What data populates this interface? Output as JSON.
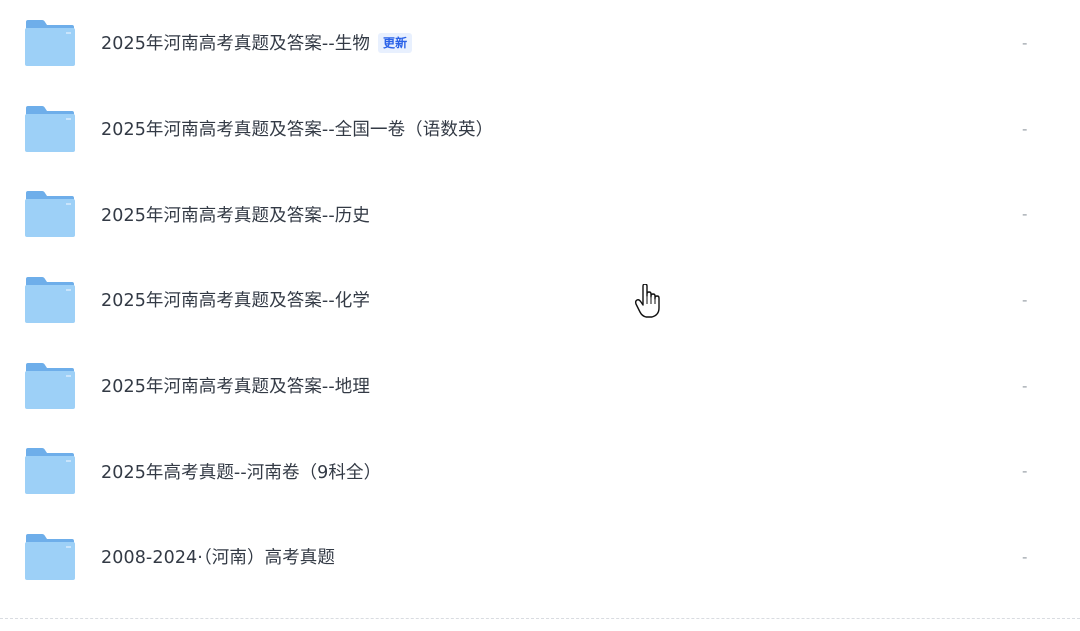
{
  "files": [
    {
      "name": "2025年河南高考真题及答案--生物",
      "badge": "更新",
      "meta": "-",
      "icon": "folder-icon"
    },
    {
      "name": "2025年河南高考真题及答案--全国一卷（语数英）",
      "badge": "",
      "meta": "-",
      "icon": "folder-icon"
    },
    {
      "name": "2025年河南高考真题及答案--历史",
      "badge": "",
      "meta": "-",
      "icon": "folder-icon"
    },
    {
      "name": "2025年河南高考真题及答案--化学",
      "badge": "",
      "meta": "-",
      "icon": "folder-icon"
    },
    {
      "name": "2025年河南高考真题及答案--地理",
      "badge": "",
      "meta": "-",
      "icon": "folder-icon"
    },
    {
      "name": "2025年高考真题--河南卷（9科全）",
      "badge": "",
      "meta": "-",
      "icon": "folder-icon"
    },
    {
      "name": "2008-2024·（河南）高考真题",
      "badge": "",
      "meta": "-",
      "icon": "folder-icon"
    }
  ],
  "colors": {
    "folder_back": "#6eaeea",
    "folder_front": "#9dd0f7",
    "badge_bg": "#e8f0fe",
    "badge_text": "#2a62e8",
    "text": "#333a45",
    "meta_text": "#9aa0a8"
  },
  "cursor": {
    "icon": "hand-pointer-cursor-icon"
  }
}
